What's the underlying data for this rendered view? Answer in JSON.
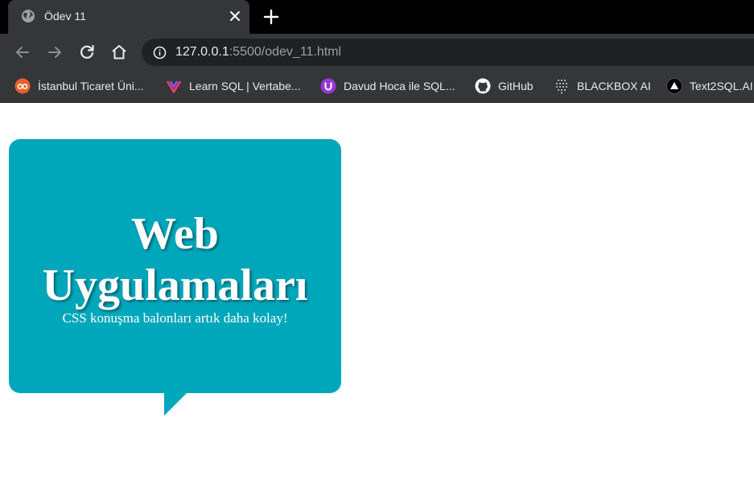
{
  "browser": {
    "tab": {
      "title": "Ödev 11"
    },
    "address": {
      "host": "127.0.0.1",
      "rest": ":5500/odev_11.html"
    },
    "bookmarks": [
      {
        "label": "İstanbul Ticaret Üni...",
        "icon": "istanbul-ticaret-icon"
      },
      {
        "label": "Learn SQL | Vertabe...",
        "icon": "vertabelo-icon"
      },
      {
        "label": "Davud Hoca ile SQL...",
        "icon": "davud-hoca-icon"
      },
      {
        "label": "GitHub",
        "icon": "github-icon"
      },
      {
        "label": "BLACKBOX AI",
        "icon": "blackbox-icon"
      },
      {
        "label": "Text2SQL.AI",
        "icon": "text2sql-icon"
      }
    ]
  },
  "page": {
    "bubble": {
      "title": "Web Uygulamaları",
      "subtitle": "CSS konuşma balonları artık daha kolay!",
      "color": "#00a7bb"
    }
  }
}
